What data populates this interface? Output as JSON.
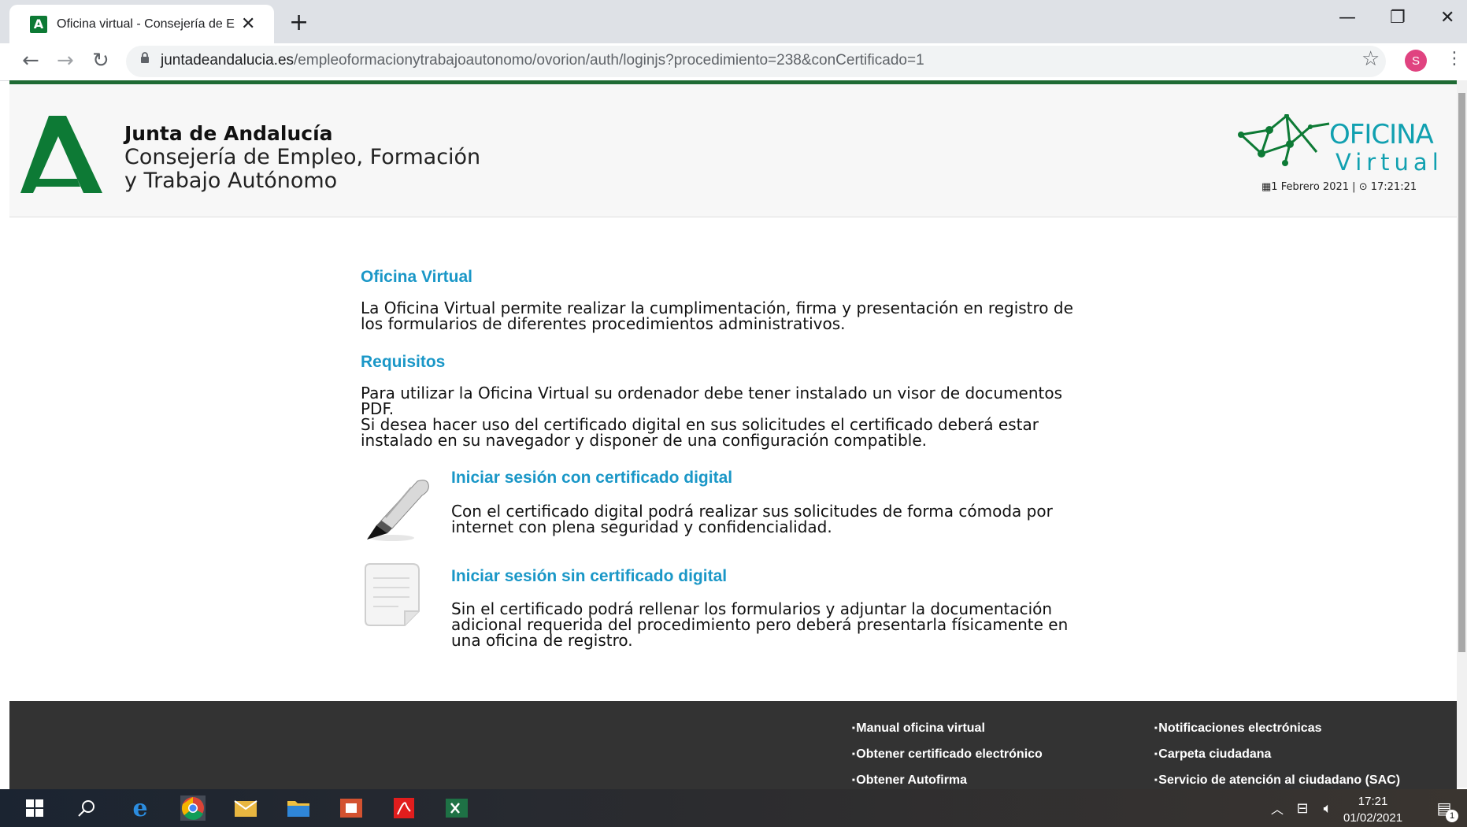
{
  "browser": {
    "tab_title": "Oficina virtual - Consejería de Em",
    "favicon_letter": "A",
    "url_host": "juntadeandalucia.es",
    "url_path": "/empleoformacionytrabajoautonomo/ovorion/auth/loginjs?procedimiento=238&conCertificado=1",
    "profile_initial": "S"
  },
  "header": {
    "org_name": "Junta de Andalucía",
    "dept_line1": "Consejería de Empleo, Formación",
    "dept_line2": "y Trabajo Autónomo",
    "ov_word1": "OFICINA",
    "ov_word2": "Virtual",
    "date": "1 Febrero 2021",
    "separator": "|",
    "time": "17:21:21"
  },
  "content": {
    "section1_title": "Oficina Virtual",
    "section1_text_l1": "La Oficina Virtual permite realizar la cumplimentación, firma y presentación en registro de",
    "section1_text_l2": "los formularios de diferentes procedimientos administrativos.",
    "section2_title": "Requisitos",
    "section2_text_l1": "Para utilizar la Oficina Virtual su ordenador debe tener instalado un visor de documentos",
    "section2_text_l2": "PDF.",
    "section2_text_l3": "Si desea hacer uso del certificado digital en sus solicitudes el certificado deberá estar",
    "section2_text_l4": "instalado en su navegador y disponer de una configuración compatible.",
    "option1_link": "Iniciar sesión con certificado digital",
    "option1_text_l1": "Con el certificado digital podrá realizar sus solicitudes de forma cómoda por",
    "option1_text_l2": "internet con plena seguridad y confidencialidad.",
    "option2_link": "Iniciar sesión sin certificado digital",
    "option2_text_l1": "Sin el certificado podrá rellenar los formularios y adjuntar la documentación",
    "option2_text_l2": "adicional requerida del procedimiento pero deberá presentarla físicamente en",
    "option2_text_l3": "una oficina de registro."
  },
  "footer": {
    "col1": [
      "Manual oficina virtual",
      "Obtener certificado electrónico",
      "Obtener Autofirma"
    ],
    "col2": [
      "Notificaciones electrónicas",
      "Carpeta ciudadana",
      "Servicio de atención al ciudadano (SAC)"
    ]
  },
  "taskbar": {
    "time": "17:21",
    "date": "01/02/2021",
    "notification_count": "1"
  },
  "colors": {
    "brand_green": "#0d7a35",
    "link_blue": "#1a97c7",
    "footer_bg": "#333333"
  }
}
